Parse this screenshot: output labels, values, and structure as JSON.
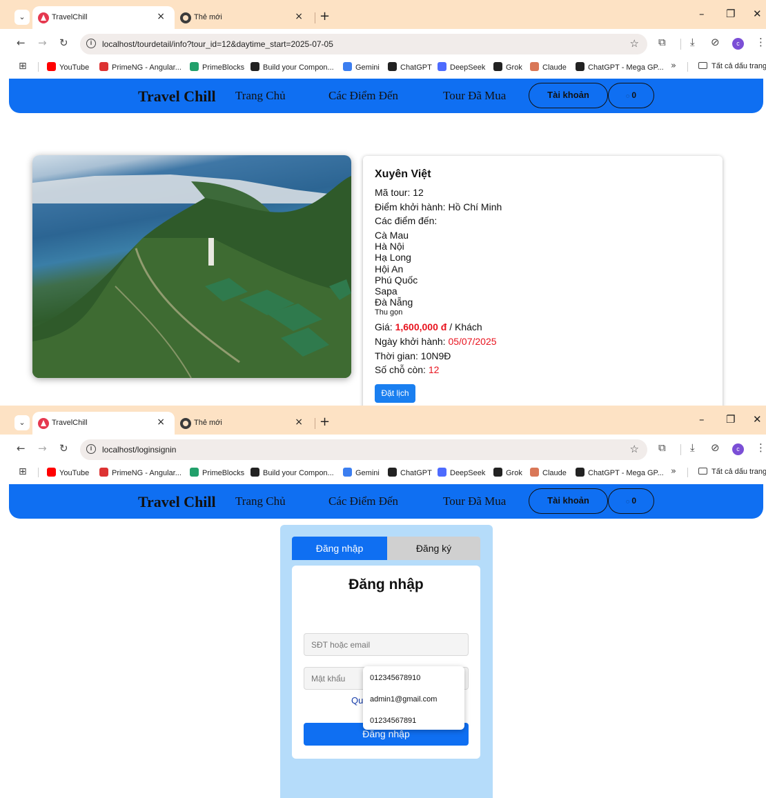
{
  "browser": {
    "tab_active": "TravelChill",
    "tab_inactive": "Thẻ mới",
    "tab_close_glyph": "×",
    "new_tab_glyph": "+",
    "avatar_letter": "c",
    "more_bookmarks": "»",
    "all_bookmarks": "Tất cả dấu trang",
    "bookmarks": [
      {
        "label": "YouTube",
        "color": "#ff0000"
      },
      {
        "label": "PrimeNG - Angular...",
        "color": "#dd3333"
      },
      {
        "label": "PrimeBlocks",
        "color": "#22a06b"
      },
      {
        "label": "Build your Compon...",
        "color": "#222222"
      },
      {
        "label": "Gemini",
        "color": "#3b7ef0"
      },
      {
        "label": "ChatGPT",
        "color": "#222222"
      },
      {
        "label": "DeepSeek",
        "color": "#4d6bfe"
      },
      {
        "label": "Grok",
        "color": "#222222"
      },
      {
        "label": "Claude",
        "color": "#d97757"
      },
      {
        "label": "ChatGPT - Mega GP...",
        "color": "#222222"
      }
    ]
  },
  "screens": [
    {
      "url": "localhost/tourdetail/info?tour_id=12&daytime_start=2025-07-05"
    },
    {
      "url": "localhost/loginsignin"
    }
  ],
  "navbar": {
    "brand": "Travel Chill",
    "links": [
      "Trang Chủ",
      "Các Điểm Đến",
      "Tour Đã Mua"
    ],
    "account": "Tài khoản",
    "cart_count": "0"
  },
  "tour": {
    "name": "Xuyên Việt",
    "code_label": "Mã tour: ",
    "code": "12",
    "departure_label": "Điểm khởi hành: ",
    "departure": "Hồ Chí Minh",
    "destinations_label": "Các điểm đến:",
    "destinations": [
      "Cà Mau",
      "Hà Nội",
      "Hạ Long",
      "Hội An",
      "Phú Quốc",
      "Sapa",
      "Đà Nẵng"
    ],
    "collapse": "Thu gọn",
    "price_label": "Giá: ",
    "price": "1,600,000 đ",
    "price_unit": " / Khách",
    "start_label": "Ngày khởi hành: ",
    "start_date": "05/07/2025",
    "duration_label": "Thời gian: ",
    "duration": "10N9Đ",
    "seats_label": "Số chỗ còn: ",
    "seats": "12",
    "book_button": "Đặt lịch"
  },
  "login": {
    "tab_login": "Đăng nhập",
    "tab_register": "Đăng ký",
    "title": "Đăng nhập",
    "username_placeholder": "SĐT hoặc email",
    "password_placeholder": "Mật khẩu",
    "forgot_partial": "Qu",
    "submit": "Đăng nhập",
    "autofill": [
      "012345678910",
      "admin1@gmail.com",
      "01234567891"
    ]
  },
  "colors": {
    "navbar": "#0f6ff2",
    "accent_red": "#e8131e",
    "login_panel": "#b5dcfa",
    "tabstrip": "#fde2c4"
  }
}
